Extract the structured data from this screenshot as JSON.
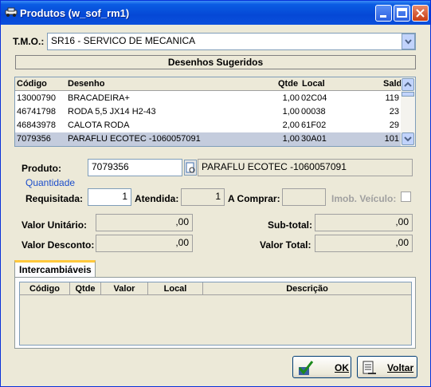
{
  "window": {
    "title": "Produtos (w_sof_rm1)"
  },
  "tmo": {
    "label": "T.M.O.:",
    "value": "SR16 - SERVICO DE MECANICA"
  },
  "section_title": "Desenhos Sugeridos",
  "grid": {
    "headers": {
      "codigo": "Código",
      "desenho": "Desenho",
      "qtde": "Qtde",
      "local": "Local",
      "saldo": "Saldo"
    },
    "rows": [
      {
        "codigo": "13000790",
        "desenho": "BRACADEIRA+",
        "qtde": "1,00",
        "local": "02C04",
        "saldo": "119"
      },
      {
        "codigo": "46741798",
        "desenho": "RODA 5,5 JX14 H2-43",
        "qtde": "1,00",
        "local": "00038",
        "saldo": "23"
      },
      {
        "codigo": "46843978",
        "desenho": "CALOTA RODA",
        "qtde": "2,00",
        "local": "61F02",
        "saldo": "29"
      },
      {
        "codigo": "7079356",
        "desenho": "PARAFLU ECOTEC -1060057091",
        "qtde": "1,00",
        "local": "30A01",
        "saldo": "101"
      }
    ]
  },
  "produto": {
    "label": "Produto:",
    "code": "7079356",
    "description": "PARAFLU ECOTEC -1060057091"
  },
  "quantidade": {
    "title": "Quantidade",
    "requisitada_label": "Requisitada:",
    "requisitada": "1",
    "atendida_label": "Atendida:",
    "atendida": "1",
    "a_comprar_label": "A Comprar:",
    "a_comprar": "",
    "imob_label": "Imob. Veículo:"
  },
  "valores": {
    "unitario_label": "Valor Unitário:",
    "unitario": ",00",
    "desconto_label": "Valor Desconto:",
    "desconto": ",00",
    "subtotal_label": "Sub-total:",
    "subtotal": ",00",
    "total_label": "Valor Total:",
    "total": ",00"
  },
  "tabs": {
    "intercambiaveis": "Intercambiáveis"
  },
  "inter_grid": {
    "headers": {
      "codigo": "Código",
      "qtde": "Qtde",
      "valor": "Valor",
      "local": "Local",
      "descricao": "Descrição"
    }
  },
  "buttons": {
    "ok": "OK",
    "voltar": "Voltar"
  }
}
